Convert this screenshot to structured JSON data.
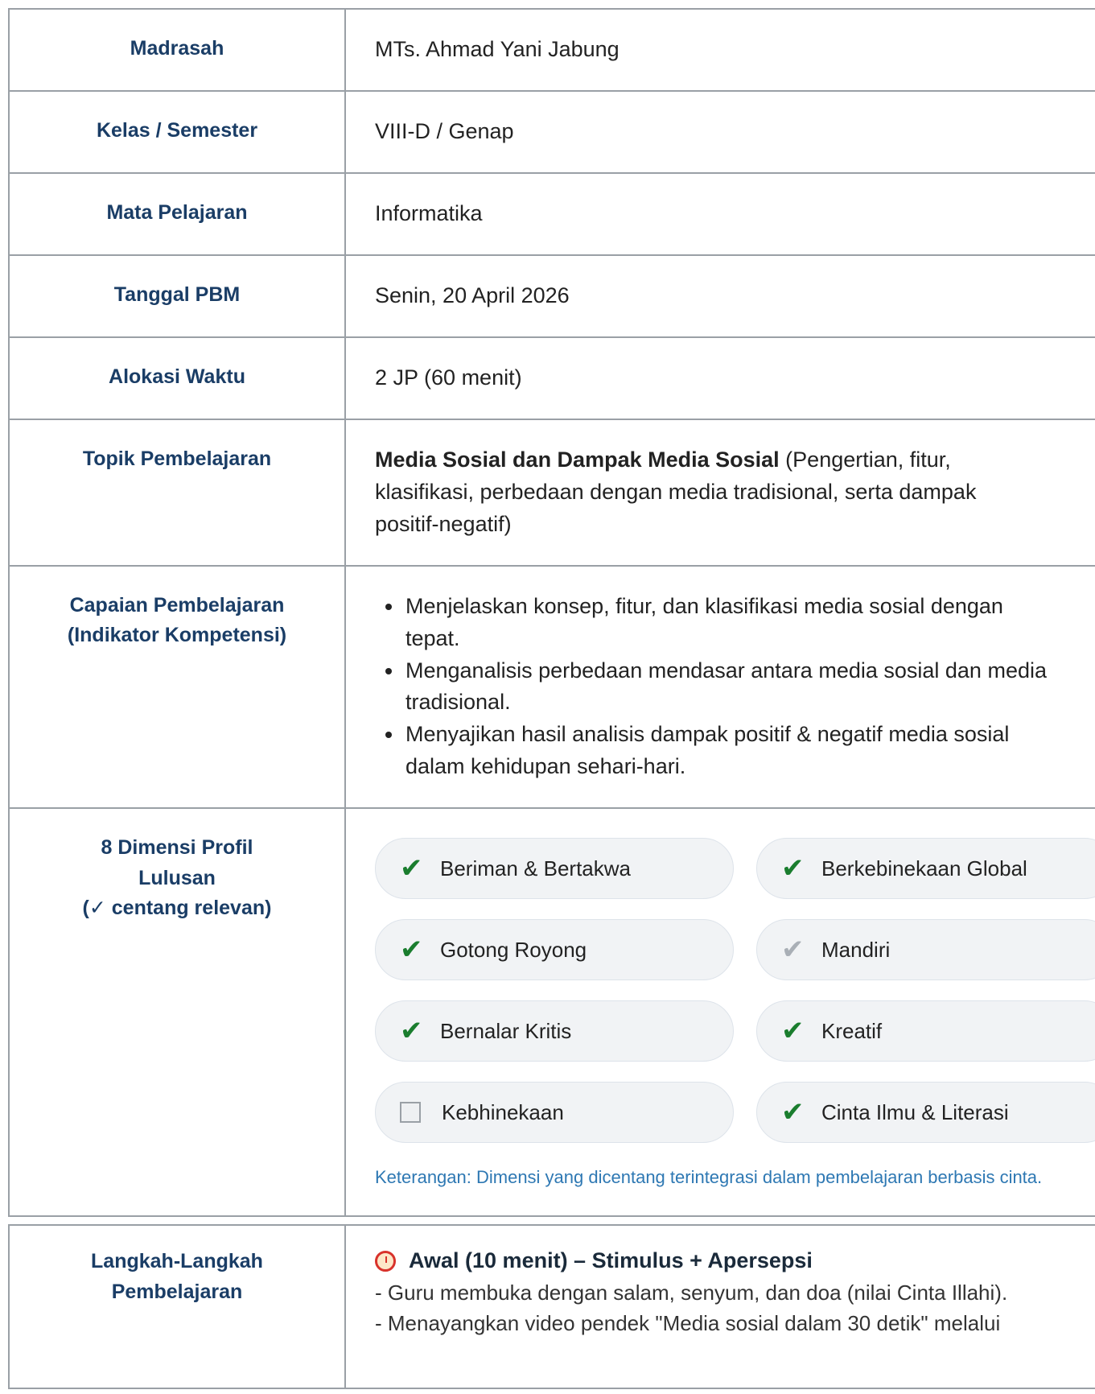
{
  "rows": {
    "madrasah": {
      "label": "Madrasah",
      "value": "MTs. Ahmad Yani Jabung"
    },
    "kelas": {
      "label": "Kelas / Semester",
      "value": "VIII-D / Genap"
    },
    "mapel": {
      "label": "Mata Pelajaran",
      "value": "Informatika"
    },
    "tanggal": {
      "label": "Tanggal PBM",
      "value": "Senin, 20 April 2026"
    },
    "alokasi": {
      "label": "Alokasi Waktu",
      "value": "2 JP (60 menit)"
    },
    "topik": {
      "label": "Topik Pembelajaran",
      "bold": "Media Sosial dan Dampak Media Sosial",
      "rest": " (Pengertian, fitur, klasifikasi, perbedaan dengan media tradisional, serta dampak positif-negatif)"
    },
    "capaian": {
      "label_line1": "Capaian Pembelajaran",
      "label_line2": "(Indikator Kompetensi)",
      "items": [
        "Menjelaskan konsep, fitur, dan klasifikasi media sosial dengan tepat.",
        "Menganalisis perbedaan mendasar antara media sosial dan media tradisional.",
        "Menyajikan hasil analisis dampak positif & negatif media sosial dalam kehidupan sehari-hari."
      ]
    },
    "dimensi": {
      "label_line1": "8 Dimensi Profil",
      "label_line2": "Lulusan",
      "label_line3": "(✓ centang relevan)",
      "items": [
        {
          "label": "Beriman & Bertakwa",
          "state": "checked",
          "mark": "✔"
        },
        {
          "label": "Berkebinekaan Global",
          "state": "checked",
          "mark": "✔"
        },
        {
          "label": "Gotong Royong",
          "state": "checked",
          "mark": "✔"
        },
        {
          "label": "Mandiri",
          "state": "grey",
          "mark": "✔"
        },
        {
          "label": "Bernalar Kritis",
          "state": "checked",
          "mark": "✔"
        },
        {
          "label": "Kreatif",
          "state": "checked",
          "mark": "✔"
        },
        {
          "label": "Kebhinekaan",
          "state": "unchecked",
          "mark": ""
        },
        {
          "label": "Cinta Ilmu & Literasi",
          "state": "checked",
          "mark": "✔"
        }
      ],
      "note": "Keterangan: Dimensi yang dicentang terintegrasi dalam pembelajaran berbasis cinta."
    }
  },
  "langkah": {
    "label_line1": "Langkah-Langkah",
    "label_line2": "Pembelajaran",
    "step_icon": "alarm-clock-icon",
    "step_title": "Awal (10 menit) – Stimulus + Apersepsi",
    "lines": [
      "- Guru membuka dengan salam, senyum, dan doa (nilai Cinta Illahi).",
      "- Menayangkan video pendek \"Media sosial dalam 30 detik\" melalui"
    ]
  },
  "colors": {
    "label": "#1a3d66",
    "check": "#1a7d2e",
    "note": "#2e78b3",
    "border": "#9aa0a6"
  }
}
